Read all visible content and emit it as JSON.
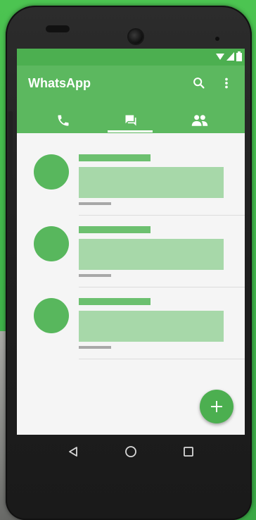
{
  "app": {
    "title": "WhatsApp"
  },
  "tabs": [
    {
      "icon": "phone-icon",
      "selected": false
    },
    {
      "icon": "chat-icon",
      "selected": true
    },
    {
      "icon": "contacts-icon",
      "selected": false
    }
  ],
  "toolbar_icons": [
    "search-icon",
    "more-vertical-icon"
  ],
  "status_icons": [
    "wifi-icon",
    "signal-icon",
    "battery-icon"
  ],
  "chats": [
    {
      "placeholder": true
    },
    {
      "placeholder": true
    },
    {
      "placeholder": true
    }
  ],
  "fab": {
    "icon": "plus-icon"
  },
  "nav_icons": [
    "back-icon",
    "home-icon",
    "recents-icon"
  ],
  "colors": {
    "statusbar": "#4caf50",
    "appbar": "#5cb85f",
    "avatar": "#58b75d",
    "name_bar": "#6cc06f",
    "message_block": "#a7d8a9",
    "time_bar": "#a8a8a8",
    "screen_bg": "#f5f5f5",
    "fab": "#4caf50",
    "background": "#45bb4e"
  }
}
